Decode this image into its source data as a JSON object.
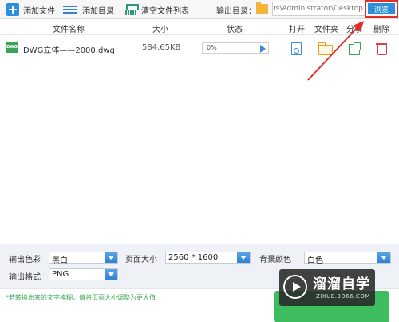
{
  "toolbar": {
    "add_file": "添加文件",
    "add_folder": "添加目录",
    "clear_list": "清空文件列表",
    "output_label": "输出目录：",
    "output_path": "ers\\Administrator\\Desktop",
    "browse": "浏览"
  },
  "table": {
    "headers": {
      "name": "文件名称",
      "size": "大小",
      "status": "状态",
      "open": "打开",
      "folder": "文件夹",
      "share": "分享",
      "delete": "删除"
    },
    "rows": [
      {
        "icon_text": "DWG",
        "name": "DWG立体——2000.dwg",
        "size": "584.65KB",
        "progress_text": "0%",
        "progress": 0
      }
    ]
  },
  "settings": {
    "color_label": "输出色彩",
    "color_value": "黑白",
    "page_size_label": "页面大小",
    "page_size_value": "2560 * 1600",
    "bg_label": "背景颜色",
    "bg_value": "白色",
    "format_label": "输出格式",
    "format_value": "PNG"
  },
  "footer": {
    "tip": "*若转换出来的文字模糊，请将页面大小调整为更大值"
  },
  "watermark": {
    "title": "溜溜自学",
    "url": "ZIXUE.3D66.COM"
  },
  "colors": {
    "accent_blue": "#2e8fd8",
    "green": "#3dbd5e",
    "highlight_red": "#e0302a"
  }
}
